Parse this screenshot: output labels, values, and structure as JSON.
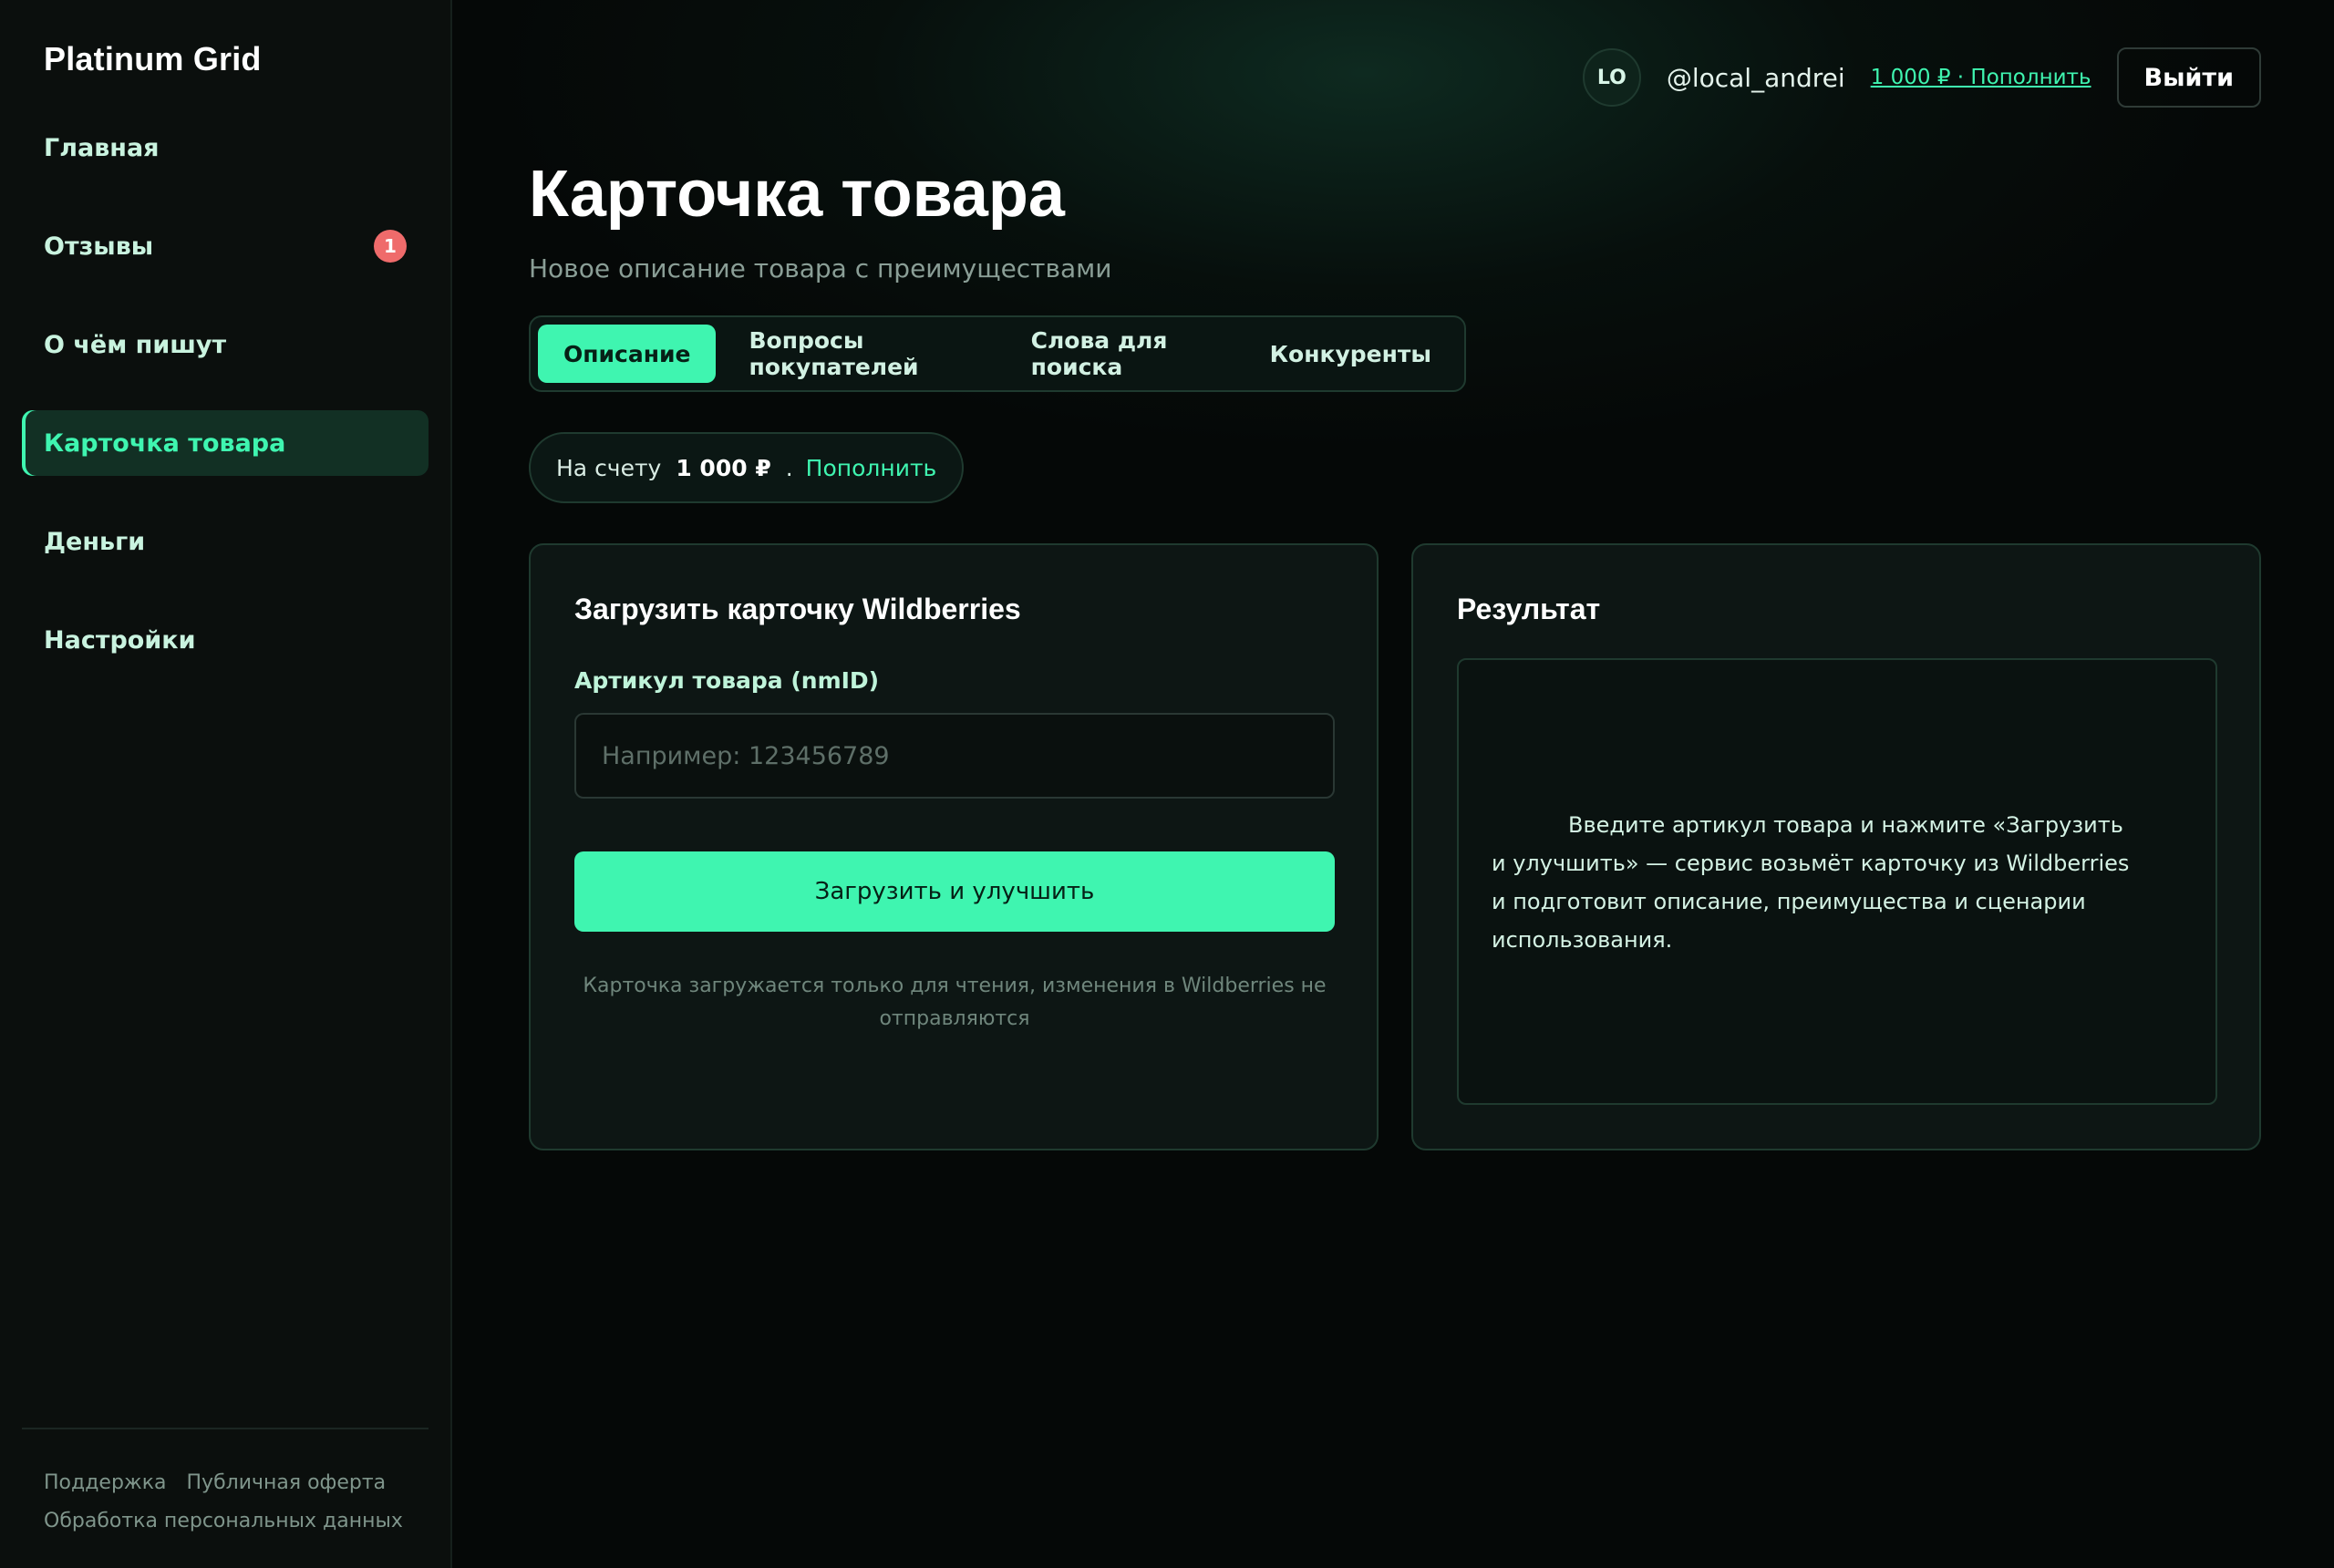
{
  "app": {
    "brand": "Platinum Grid"
  },
  "sidebar": {
    "items": [
      {
        "label": "Главная",
        "active": false
      },
      {
        "label": "Отзывы",
        "active": false,
        "badge": "1"
      },
      {
        "label": "О чём пишут",
        "active": false
      },
      {
        "label": "Карточка товара",
        "active": true
      },
      {
        "label": "Деньги",
        "active": false
      },
      {
        "label": "Настройки",
        "active": false
      }
    ],
    "footer": {
      "support": "Поддержка",
      "offer": "Публичная оферта",
      "privacy": "Обработка персональных данных"
    }
  },
  "header": {
    "avatar_initials": "LO",
    "username": "@local_andrei",
    "balance_link": "1 000 ₽ · Пополнить",
    "logout": "Выйти"
  },
  "page": {
    "title": "Карточка товара",
    "subtitle": "Новое описание товара с преимуществами"
  },
  "tabs": [
    {
      "label": "Описание",
      "active": true
    },
    {
      "label": "Вопросы покупателей",
      "active": false
    },
    {
      "label": "Слова для поиска",
      "active": false
    },
    {
      "label": "Конкуренты",
      "active": false
    }
  ],
  "balance": {
    "label": "На счету",
    "amount": "1 000 ₽",
    "separator": ".",
    "topup": "Пополнить"
  },
  "load_card": {
    "title": "Загрузить карточку Wildberries",
    "field_label": "Артикул товара (nmID)",
    "placeholder": "Например: 123456789",
    "value": "",
    "button": "Загрузить и улучшить",
    "hint": "Карточка загружается только для чтения, изменения в Wildberries не отправляются"
  },
  "result": {
    "title": "Результат",
    "empty_text": "Введите артикул товара и нажмите «Загрузить и улучшить» — сервис возьмёт карточку из Wildberries и подготовит описание, преимущества и сценарии использования."
  },
  "colors": {
    "accent": "#3ff5b0",
    "background": "#050807",
    "sidebar": "#0b0f0d",
    "card": "#0d1614",
    "badge": "#ef6b6b"
  }
}
